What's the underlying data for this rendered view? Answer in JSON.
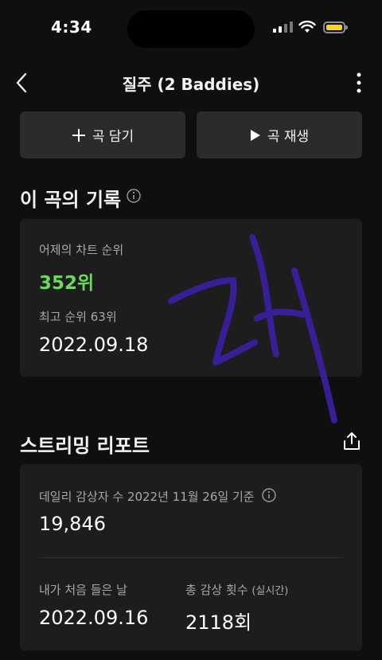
{
  "status_bar": {
    "time": "4:34"
  },
  "header": {
    "title": "질주 (2 Baddies)"
  },
  "actions": {
    "add_label": "곡 담기",
    "play_label": "곡 재생"
  },
  "song_record": {
    "section_title": "이 곡의 기록",
    "yesterday_rank_label": "어제의 차트 순위",
    "yesterday_rank_value": "352위",
    "best_rank_label": "최고 순위 63위",
    "best_rank_date": "2022.09.18"
  },
  "streaming_report": {
    "section_title": "스트리밍 리포트",
    "daily_listeners_label": "데일리 감상자 수 2022년 11월 26일 기준",
    "daily_listeners_value": "19,846",
    "first_listen_label": "내가 처음 들은 날",
    "first_listen_value": "2022.09.16",
    "total_plays_label": "총 감상 횟수",
    "total_plays_note": "(실시간)",
    "total_plays_value": "2118회"
  },
  "colors": {
    "accent_green": "#6bd95a",
    "scribble": "#3a1f9e",
    "battery": "#f5d233"
  }
}
